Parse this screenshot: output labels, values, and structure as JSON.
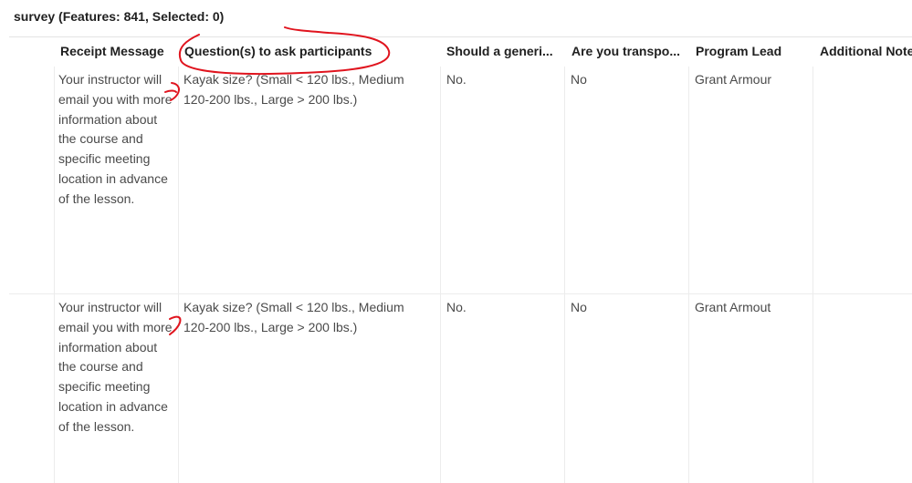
{
  "layer": {
    "title": "survey (Features: 841, Selected: 0)"
  },
  "table": {
    "headers": [
      "Receipt Message",
      "Question(s) to ask participants",
      "Should a generi...",
      "Are you transpo...",
      "Program Lead",
      "Additional Note"
    ],
    "rows": [
      {
        "receipt_message": "Your instructor will email you with more information about the course and specific meeting location in advance of the lesson.",
        "questions": "Kayak size? (Small < 120 lbs., Medium 120-200 lbs., Large > 200 lbs.)",
        "generic": "No.",
        "transport": "No",
        "program_lead": "Grant Armour",
        "additional_notes": ""
      },
      {
        "receipt_message": "Your instructor will email you with more information about the course and specific meeting location in advance of the lesson.",
        "questions": "Kayak size? (Small < 120 lbs., Medium 120-200 lbs., Large > 200 lbs.)",
        "generic": "No.",
        "transport": "No",
        "program_lead": "Grant Armout",
        "additional_notes": ""
      }
    ]
  },
  "annotation": {
    "color": "#e0141e"
  }
}
